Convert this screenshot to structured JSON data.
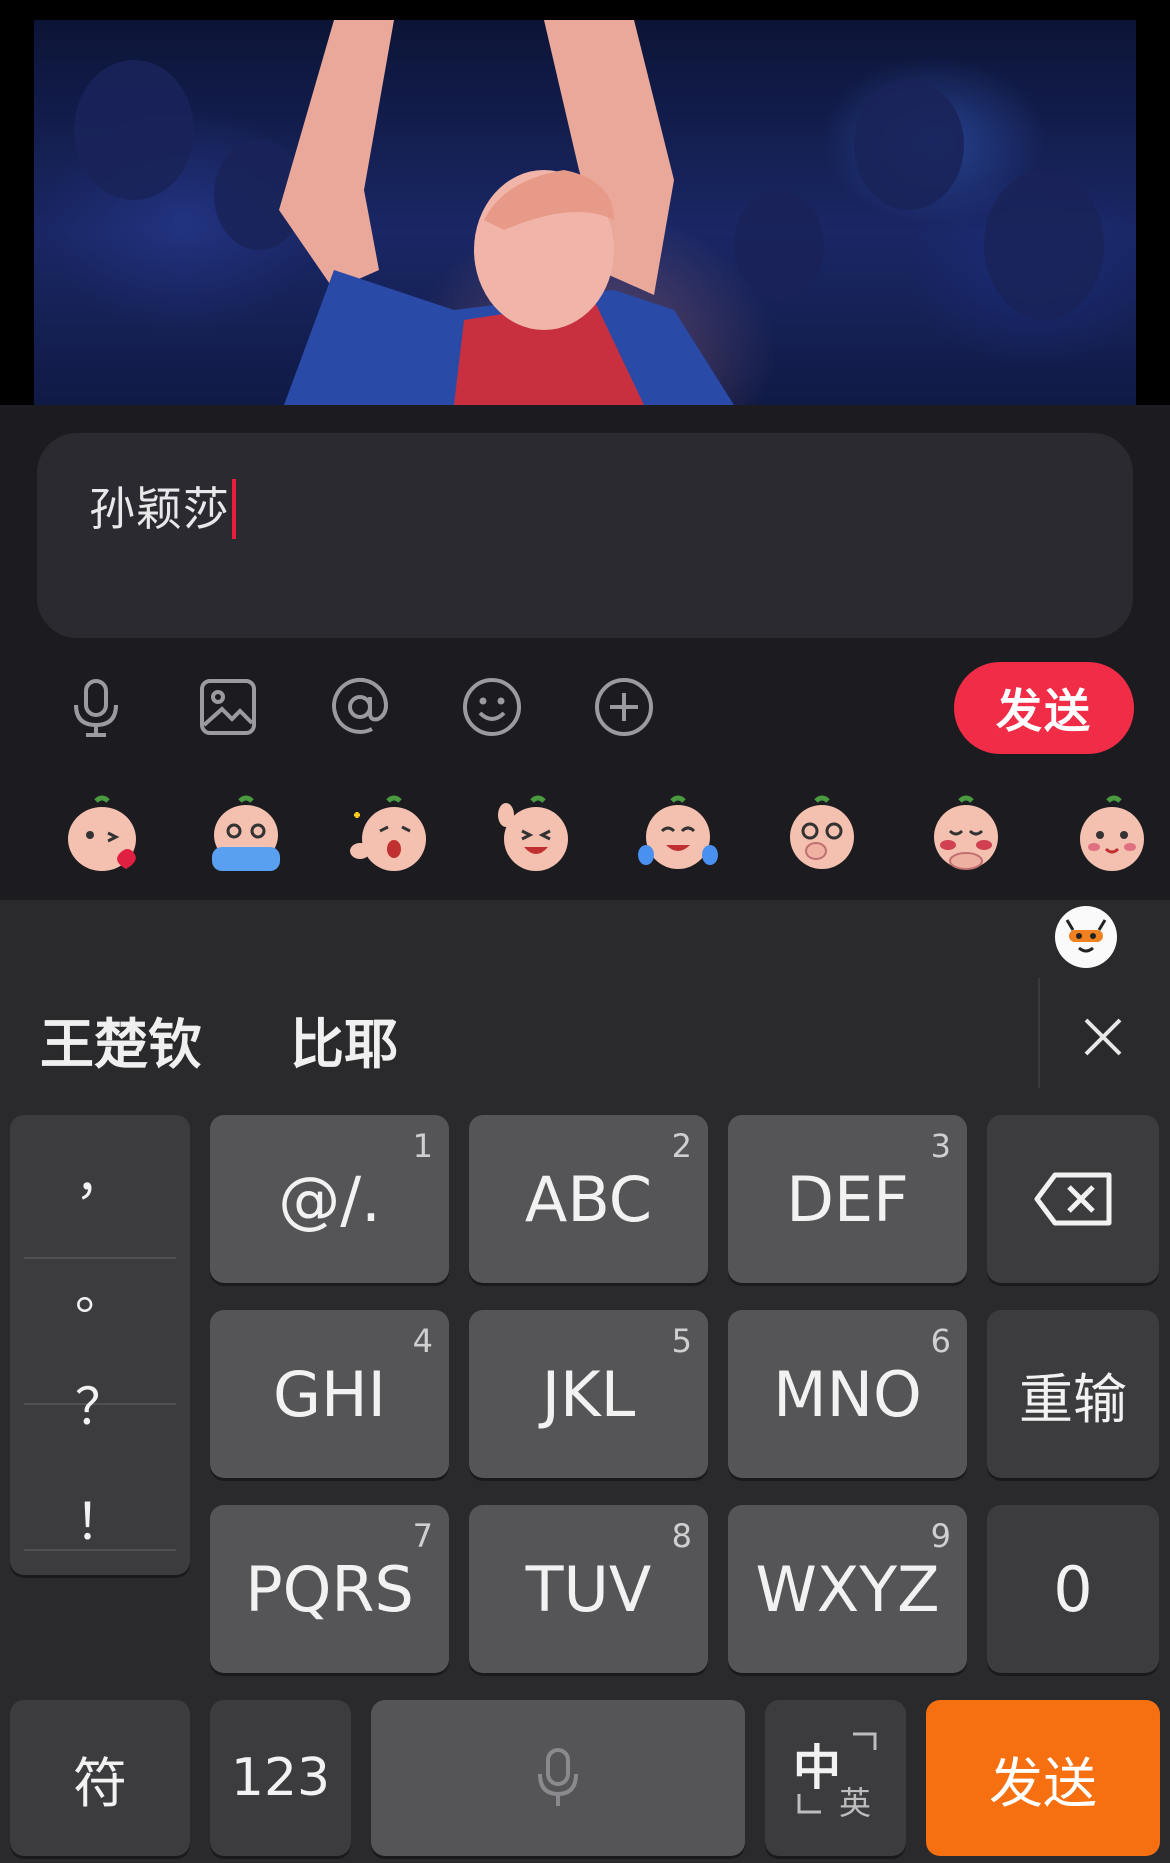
{
  "composer": {
    "input_text": "孙颖莎",
    "send_label": "发送",
    "toolbar_icons": [
      "microphone-icon",
      "image-icon",
      "at-icon",
      "emoji-icon",
      "plus-icon"
    ],
    "stickers": [
      "kiss-sticker",
      "crying-sticker",
      "surprised-sticker",
      "laughing-sticker",
      "tears-of-joy-sticker",
      "covering-mouth-sticker",
      "shy-sticker",
      "smiling-sticker"
    ]
  },
  "keyboard": {
    "candidates": [
      "王楚钦",
      "比耶"
    ],
    "punctuation": [
      "，",
      "。",
      "？",
      "！"
    ],
    "keys": [
      {
        "label": "@/.",
        "num": "1"
      },
      {
        "label": "ABC",
        "num": "2"
      },
      {
        "label": "DEF",
        "num": "3"
      },
      {
        "label": "GHI",
        "num": "4"
      },
      {
        "label": "JKL",
        "num": "5"
      },
      {
        "label": "MNO",
        "num": "6"
      },
      {
        "label": "PQRS",
        "num": "7"
      },
      {
        "label": "TUV",
        "num": "8"
      },
      {
        "label": "WXYZ",
        "num": "9"
      }
    ],
    "reinput_label": "重输",
    "zero_label": "0",
    "symbol_label": "符",
    "numeric_label": "123",
    "lang_main": "中",
    "lang_alt": "英",
    "send_label": "发送"
  },
  "colors": {
    "send_pill": "#f02c46",
    "keyboard_send": "#f67012",
    "caret": "#e61e3c"
  }
}
